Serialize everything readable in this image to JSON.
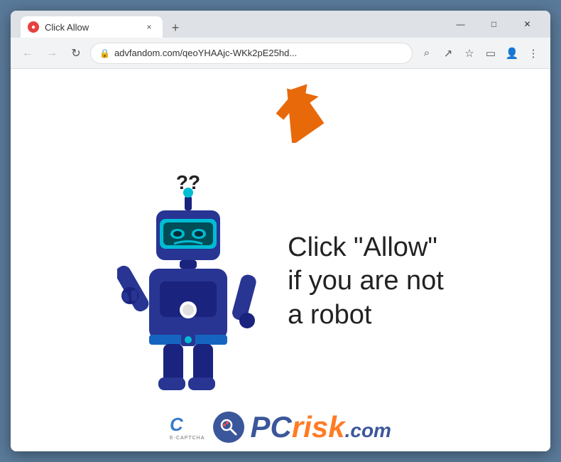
{
  "browser": {
    "tab": {
      "favicon": "●",
      "title": "Click Allow",
      "close_label": "×"
    },
    "new_tab_label": "+",
    "nav": {
      "back_label": "←",
      "forward_label": "→",
      "reload_label": "↻"
    },
    "url": "advfandom.com/qeoYHAAjc-WKk2pE25hd...",
    "toolbar": {
      "search_label": "⌕",
      "share_label": "↗",
      "bookmark_label": "☆",
      "split_label": "▭",
      "profile_label": "👤",
      "menu_label": "⋮"
    }
  },
  "page": {
    "main_text_line1": "Click \"Allow\"",
    "main_text_line2": "if you are not",
    "main_text_line3": "a robot",
    "ecaptcha_c": "C",
    "ecaptcha_label": "E-CAPTCHA",
    "pcrisk_text": "PC",
    "risk_text": "risk",
    "dotcom_text": ".com"
  },
  "window_controls": {
    "minimize": "—",
    "maximize": "□",
    "close": "✕"
  }
}
